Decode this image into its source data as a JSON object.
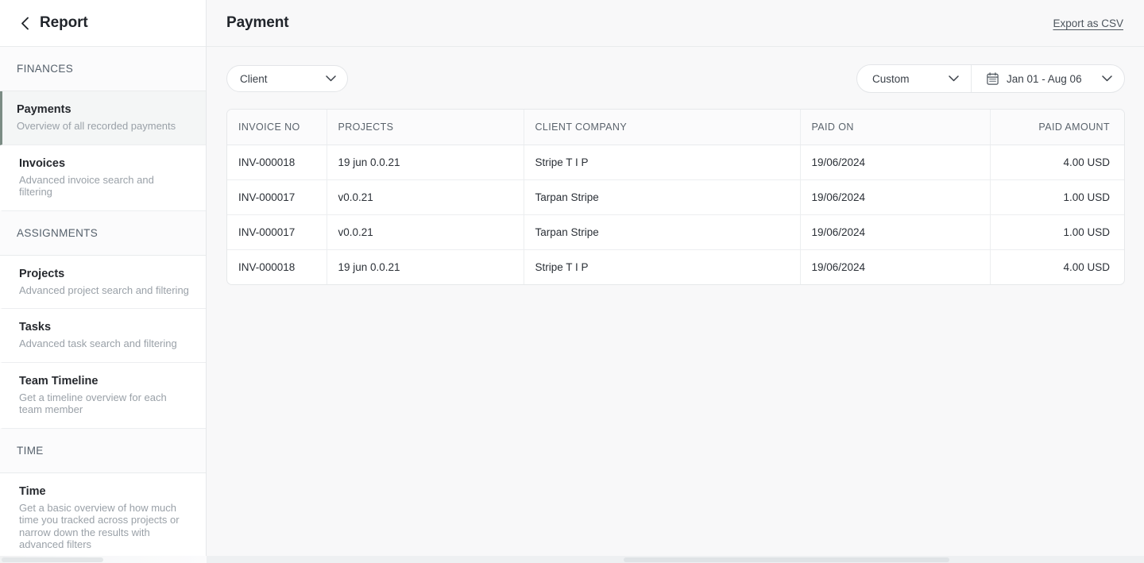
{
  "sidebar": {
    "back_icon": "chevron-left-icon",
    "title": "Report",
    "sections": [
      {
        "label": "FINANCES",
        "items": [
          {
            "title": "Payments",
            "sub": "Overview of all recorded payments",
            "active": true
          },
          {
            "title": "Invoices",
            "sub": "Advanced invoice search and filtering",
            "active": false
          }
        ]
      },
      {
        "label": "ASSIGNMENTS",
        "items": [
          {
            "title": "Projects",
            "sub": "Advanced project search and filtering",
            "active": false
          },
          {
            "title": "Tasks",
            "sub": "Advanced task search and filtering",
            "active": false
          },
          {
            "title": "Team Timeline",
            "sub": "Get a timeline overview for each team member",
            "active": false
          }
        ]
      },
      {
        "label": "TIME",
        "items": [
          {
            "title": "Time",
            "sub": "Get a basic overview of how much time you tracked across projects or narrow down the results with advanced filters",
            "active": false
          }
        ]
      }
    ]
  },
  "header": {
    "title": "Payment",
    "export_label": "Export as CSV"
  },
  "toolbar": {
    "client_filter": {
      "label": "Client",
      "icon": "chevron-down-icon"
    },
    "range_preset": {
      "label": "Custom",
      "icon": "chevron-down-icon"
    },
    "date_range": {
      "label": "Jan 01 - Aug 06",
      "icon": "calendar-icon",
      "chevron": "chevron-down-icon"
    }
  },
  "table": {
    "columns": [
      {
        "key": "invoice_no",
        "label": "INVOICE NO",
        "align": "left"
      },
      {
        "key": "projects",
        "label": "PROJECTS",
        "align": "left"
      },
      {
        "key": "client_company",
        "label": "CLIENT COMPANY",
        "align": "left"
      },
      {
        "key": "paid_on",
        "label": "PAID ON",
        "align": "left"
      },
      {
        "key": "paid_amount",
        "label": "PAID AMOUNT",
        "align": "right"
      }
    ],
    "rows": [
      {
        "invoice_no": "INV-000018",
        "projects": "19 jun 0.0.21",
        "client_company": "Stripe T I P",
        "paid_on": "19/06/2024",
        "paid_amount": "4.00 USD"
      },
      {
        "invoice_no": "INV-000017",
        "projects": "v0.0.21",
        "client_company": "Tarpan Stripe",
        "paid_on": "19/06/2024",
        "paid_amount": "1.00 USD"
      },
      {
        "invoice_no": "INV-000017",
        "projects": "v0.0.21",
        "client_company": "Tarpan Stripe",
        "paid_on": "19/06/2024",
        "paid_amount": "1.00 USD"
      },
      {
        "invoice_no": "INV-000018",
        "projects": "19 jun 0.0.21",
        "client_company": "Stripe T I P",
        "paid_on": "19/06/2024",
        "paid_amount": "4.00 USD"
      }
    ]
  },
  "colors": {
    "active_accent": "#7b8c84",
    "active_bg": "#f4f6f6",
    "page_bg": "#f8f8f9",
    "border": "#e6e8ea",
    "text_primary": "#21252b",
    "text_muted": "#9aa1a8"
  }
}
